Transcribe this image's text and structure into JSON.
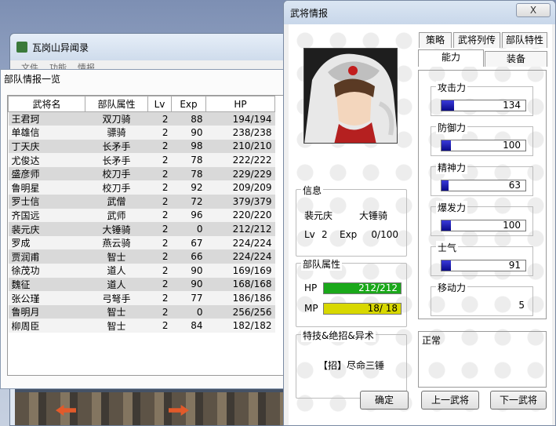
{
  "back_window": {
    "title": "瓦岗山异闻录",
    "menu": [
      "文件",
      "功能",
      "情报"
    ]
  },
  "unit_list": {
    "title": "部队情报一览",
    "columns": [
      "武将名",
      "部队属性",
      "Lv",
      "Exp",
      "HP"
    ],
    "rows": [
      [
        "王君珂",
        "双刀骑",
        "2",
        "88",
        "194/194"
      ],
      [
        "单雄信",
        "骠骑",
        "2",
        "90",
        "238/238"
      ],
      [
        "丁天庆",
        "长矛手",
        "2",
        "98",
        "210/210"
      ],
      [
        "尤俊达",
        "长矛手",
        "2",
        "78",
        "222/222"
      ],
      [
        "盛彦师",
        "校刀手",
        "2",
        "78",
        "229/229"
      ],
      [
        "鲁明星",
        "校刀手",
        "2",
        "92",
        "209/209"
      ],
      [
        "罗士信",
        "武僧",
        "2",
        "72",
        "379/379"
      ],
      [
        "齐国远",
        "武师",
        "2",
        "96",
        "220/220"
      ],
      [
        "裴元庆",
        "大锤骑",
        "2",
        "0",
        "212/212"
      ],
      [
        "罗成",
        "燕云骑",
        "2",
        "67",
        "224/224"
      ],
      [
        "贾润甫",
        "智士",
        "2",
        "66",
        "224/224"
      ],
      [
        "徐茂功",
        "道人",
        "2",
        "90",
        "169/169"
      ],
      [
        "魏征",
        "道人",
        "2",
        "90",
        "168/168"
      ],
      [
        "张公瑾",
        "弓弩手",
        "2",
        "77",
        "186/186"
      ],
      [
        "鲁明月",
        "智士",
        "2",
        "0",
        "256/256"
      ],
      [
        "柳周臣",
        "智士",
        "2",
        "84",
        "182/182"
      ]
    ]
  },
  "dialog": {
    "title": "武将情报",
    "close_label": "X",
    "tabs_top": [
      "策略",
      "武将列传",
      "部队特性"
    ],
    "tabs_bottom": [
      "能力",
      "装备"
    ],
    "info": {
      "legend": "信息",
      "name": "裴元庆",
      "unit_type": "大锤骑",
      "lv_label": "Lv",
      "lv": "2",
      "exp_label": "Exp",
      "exp": "0/100"
    },
    "unit_attr": {
      "legend": "部队属性",
      "hp_label": "HP",
      "hp_text": "212/212",
      "hp_fraction": 1.0,
      "hp_color": "#1aa81a",
      "mp_label": "MP",
      "mp_text": "18/ 18",
      "mp_fraction": 1.0,
      "mp_color": "#d8d800"
    },
    "skills": {
      "legend": "特技&绝招&异术",
      "value": "【招】尽命三锤"
    },
    "abilities": [
      {
        "label": "攻击力",
        "value": "134",
        "fraction": 0.15
      },
      {
        "label": "防御力",
        "value": "100",
        "fraction": 0.11
      },
      {
        "label": "精神力",
        "value": "63",
        "fraction": 0.08
      },
      {
        "label": "爆发力",
        "value": "100",
        "fraction": 0.11
      },
      {
        "label": "士气",
        "value": "91",
        "fraction": 0.11
      },
      {
        "label": "移动力",
        "value": "5"
      }
    ],
    "status_legend": "正常",
    "buttons": {
      "ok": "确定",
      "prev": "上一武将",
      "next": "下一武将"
    }
  }
}
